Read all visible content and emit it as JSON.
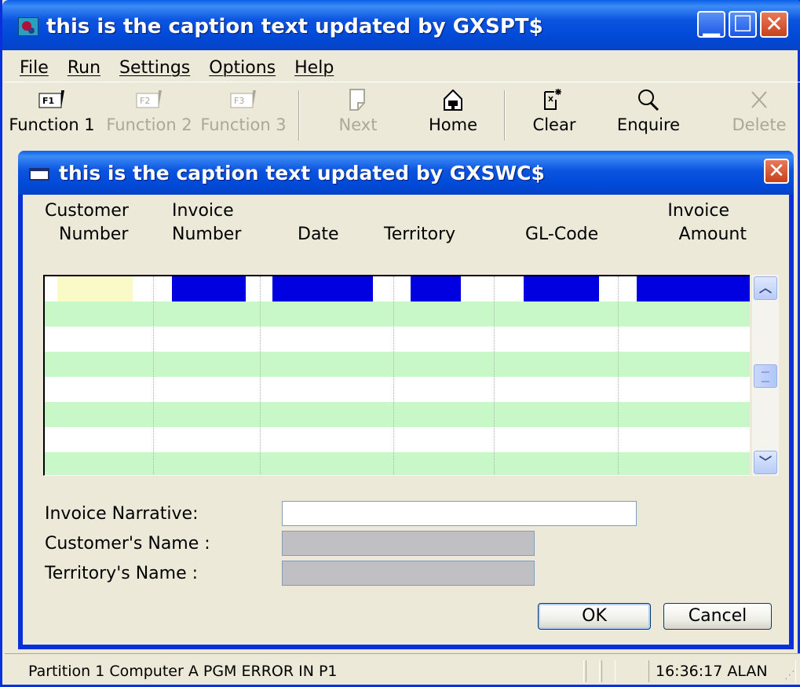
{
  "outer_window": {
    "title": "this is the caption text updated by GXSPT$",
    "minimize_glyph": "▁",
    "maximize_glyph": "☐",
    "close_glyph": "✕"
  },
  "menu": [
    "File",
    "Run",
    "Settings",
    "Options",
    "Help"
  ],
  "toolbar": {
    "function1": "Function 1",
    "function2": "Function 2",
    "function3": "Function 3",
    "next": "Next",
    "home": "Home",
    "clear": "Clear",
    "enquire": "Enquire",
    "delete": "Delete"
  },
  "dialog": {
    "title": "this is the caption text updated by GXSWC$",
    "close_glyph": "✕",
    "columns": {
      "customer_line1": "Customer",
      "customer_line2": "Number",
      "invoice_line1": "Invoice",
      "invoice_line2": "Number",
      "date": "Date",
      "territory": "Territory",
      "glcode": "GL-Code",
      "amount_line1": "Invoice",
      "amount_line2": "Amount"
    },
    "form": {
      "narrative_label": "Invoice Narrative:",
      "narrative_value": "",
      "customer_name_label": "Customer's  Name :",
      "territory_name_label": "Territory's Name :"
    },
    "ok": "OK",
    "cancel": "Cancel"
  },
  "status": {
    "message": "Partition 1 Computer A  PGM ERROR IN P1",
    "time_user": "16:36:17  ALAN"
  }
}
